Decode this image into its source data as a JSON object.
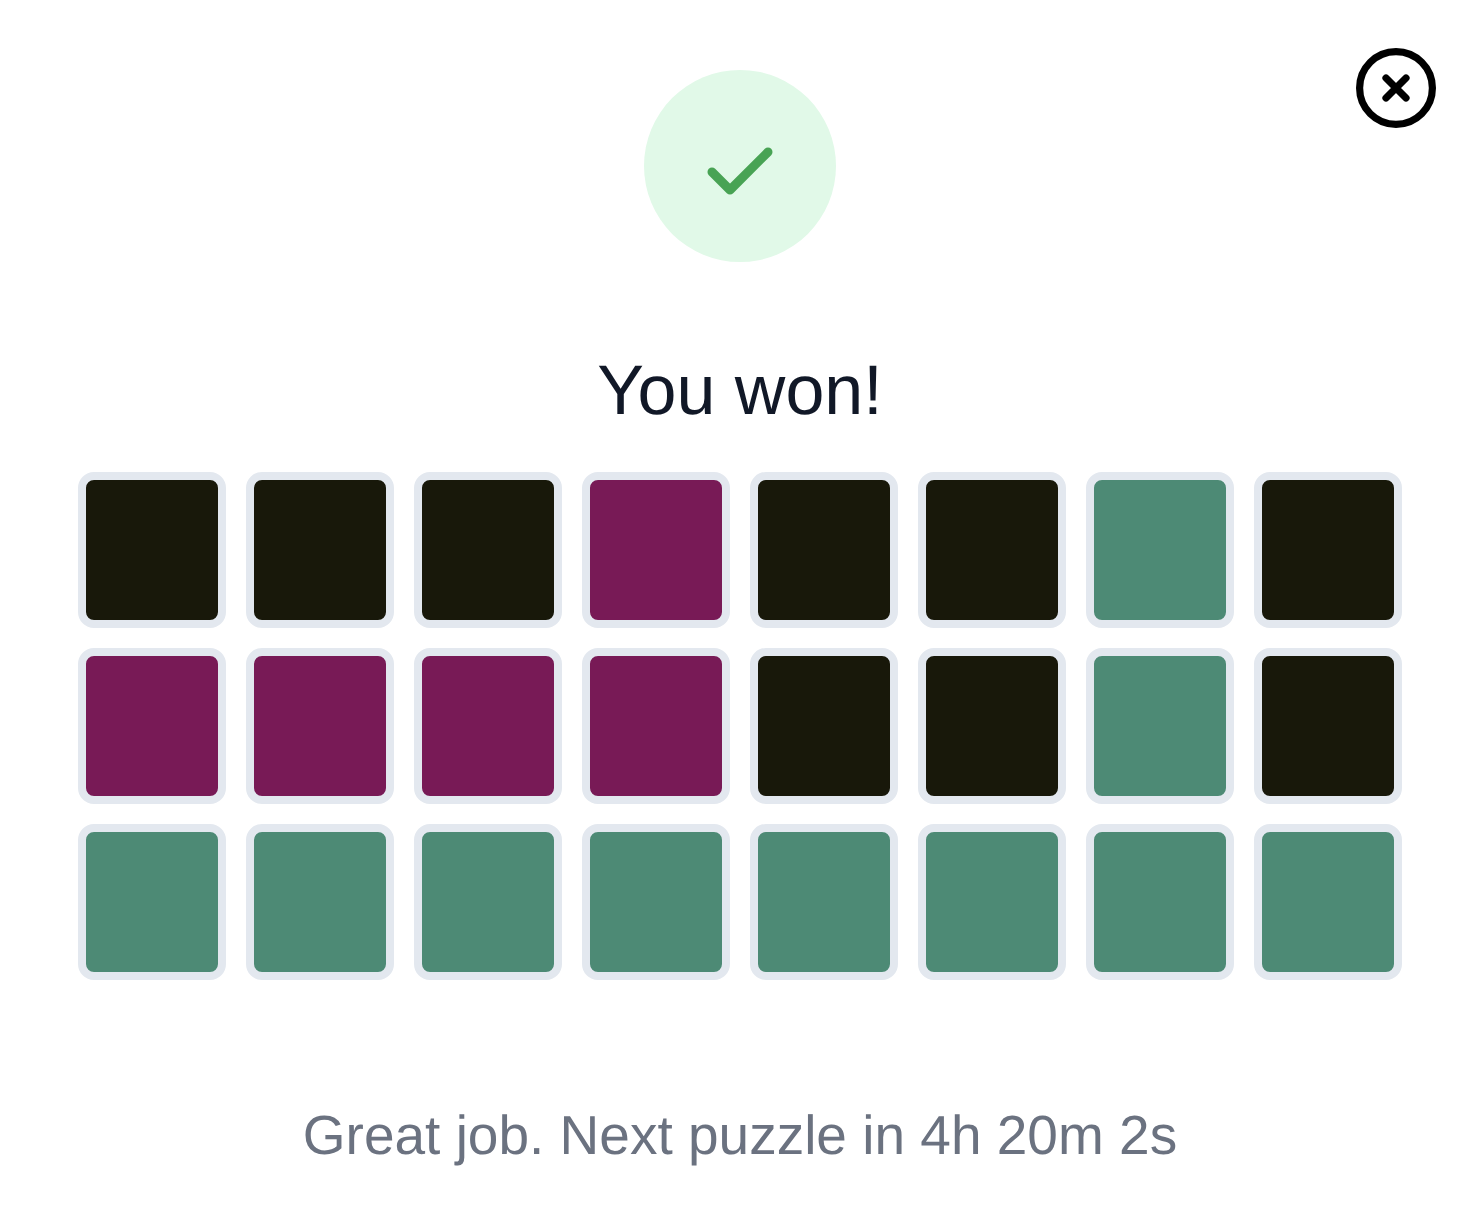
{
  "result": {
    "title": "You won!"
  },
  "board": {
    "rows": [
      {
        "tiles": [
          {
            "color": "#18180a"
          },
          {
            "color": "#18180a"
          },
          {
            "color": "#18180a"
          },
          {
            "color": "#781a56"
          },
          {
            "color": "#18180a"
          },
          {
            "color": "#18180a"
          },
          {
            "color": "#4d8a75"
          },
          {
            "color": "#18180a"
          }
        ]
      },
      {
        "tiles": [
          {
            "color": "#781a56"
          },
          {
            "color": "#781a56"
          },
          {
            "color": "#781a56"
          },
          {
            "color": "#781a56"
          },
          {
            "color": "#18180a"
          },
          {
            "color": "#18180a"
          },
          {
            "color": "#4d8a75"
          },
          {
            "color": "#18180a"
          }
        ]
      },
      {
        "tiles": [
          {
            "color": "#4d8a75"
          },
          {
            "color": "#4d8a75"
          },
          {
            "color": "#4d8a75"
          },
          {
            "color": "#4d8a75"
          },
          {
            "color": "#4d8a75"
          },
          {
            "color": "#4d8a75"
          },
          {
            "color": "#4d8a75"
          },
          {
            "color": "#4d8a75"
          }
        ]
      }
    ]
  },
  "footer": {
    "message": "Great job. Next puzzle in 4h 20m 2s"
  }
}
